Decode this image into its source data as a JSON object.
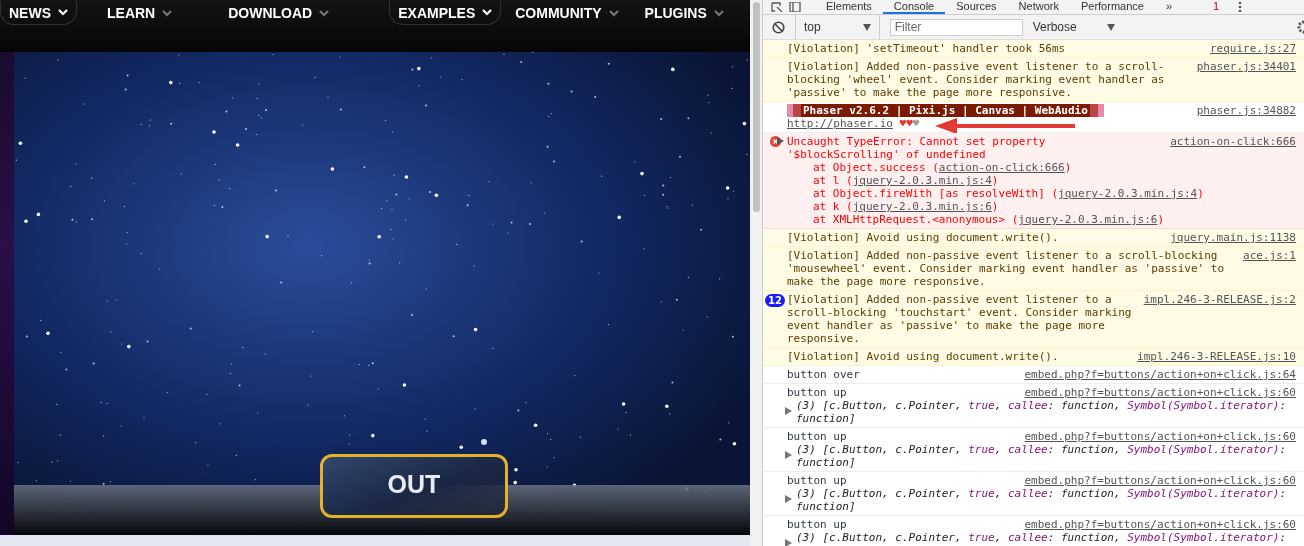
{
  "site_nav": {
    "items": [
      {
        "label": "NEWS",
        "outlined": true
      },
      {
        "label": "LEARN",
        "outlined": false
      },
      {
        "label": "DOWNLOAD",
        "outlined": false
      },
      {
        "label": "EXAMPLES",
        "outlined": true
      },
      {
        "label": "COMMUNITY",
        "outlined": false
      },
      {
        "label": "PLUGINS",
        "outlined": false
      }
    ]
  },
  "game": {
    "button_label": "OUT"
  },
  "devtools": {
    "tabs": [
      {
        "label": "Elements",
        "selected": false
      },
      {
        "label": "Console",
        "selected": true
      },
      {
        "label": "Sources",
        "selected": false
      },
      {
        "label": "Network",
        "selected": false
      },
      {
        "label": "Performance",
        "selected": false
      }
    ],
    "overflow": "»",
    "error_count": "1",
    "context": "top",
    "filter": {
      "placeholder": "Filter"
    },
    "level": "Verbose",
    "messages": [
      {
        "kind": "violation",
        "text": "[Violation] 'setTimeout' handler took 56ms",
        "source": "require.js:27"
      },
      {
        "kind": "violation",
        "text": "[Violation] Added non-passive event listener to a scroll-blocking 'wheel' event. Consider marking event handler as 'passive' to make the page more responsive.",
        "source": "phaser.js:34401"
      },
      {
        "kind": "banner",
        "banner": "Phaser v2.6.2 | Pixi.js | Canvas | WebAudio",
        "link": "http://phaser.io",
        "hearts": [
          {
            "char": "♥",
            "color": "#e53935"
          },
          {
            "char": "♥",
            "color": "#e53935"
          },
          {
            "char": "♥",
            "color": "#9e9e9e"
          }
        ],
        "source": "phaser.js:34882"
      },
      {
        "kind": "error",
        "text": "Uncaught TypeError: Cannot set property '$blockScrolling' of undefined",
        "source": "action-on-click:666",
        "stack": [
          {
            "text": "at Object.success (",
            "link": "action-on-click:666",
            "end": ")"
          },
          {
            "text": "at l (",
            "link": "jquery-2.0.3.min.js:4",
            "end": ")"
          },
          {
            "text": "at Object.fireWith [as resolveWith] (",
            "link": "jquery-2.0.3.min.js:4",
            "end": ")"
          },
          {
            "text": "at k (",
            "link": "jquery-2.0.3.min.js:6",
            "end": ")"
          },
          {
            "text": "at XMLHttpRequest.<anonymous> (",
            "link": "jquery-2.0.3.min.js:6",
            "end": ")"
          }
        ]
      },
      {
        "kind": "violation",
        "text": "[Violation] Avoid using document.write().",
        "source": "jquery.main.js:1138"
      },
      {
        "kind": "violation",
        "text": "[Violation] Added non-passive event listener to a scroll-blocking 'mousewheel' event. Consider marking event handler as 'passive' to make the page more responsive.",
        "source": "ace.js:1"
      },
      {
        "kind": "violation",
        "count": "12",
        "text": "[Violation] Added non-passive event listener to a scroll-blocking 'touchstart' event. Consider marking event handler as 'passive' to make the page more responsive.",
        "source": "impl.246-3-RELEASE.js:2"
      },
      {
        "kind": "violation",
        "text": "[Violation] Avoid using document.write().",
        "source": "impl.246-3-RELEASE.js:10"
      },
      {
        "kind": "log",
        "text": "button over",
        "source": "embed.php?f=buttons/action+on+click.js:64"
      },
      {
        "kind": "log",
        "text": "button up",
        "source": "embed.php?f=buttons/action+on+click.js:60",
        "object": [
          {
            "text": "(3) [c.Button, c.Pointer, ",
            "kind": "plain"
          },
          {
            "text": "true",
            "kind": "keyword"
          },
          {
            "text": ", ",
            "kind": "plain"
          },
          {
            "text": "callee",
            "kind": "key"
          },
          {
            "text": ": function, ",
            "kind": "plain"
          },
          {
            "text": "Symbol(Symbol.iterator)",
            "kind": "key"
          },
          {
            "text": ": function]",
            "kind": "plain"
          }
        ]
      },
      {
        "kind": "log",
        "text": "button up",
        "source": "embed.php?f=buttons/action+on+click.js:60",
        "object": [
          {
            "text": "(3) [c.Button, c.Pointer, ",
            "kind": "plain"
          },
          {
            "text": "true",
            "kind": "keyword"
          },
          {
            "text": ", ",
            "kind": "plain"
          },
          {
            "text": "callee",
            "kind": "key"
          },
          {
            "text": ": function, ",
            "kind": "plain"
          },
          {
            "text": "Symbol(Symbol.iterator)",
            "kind": "key"
          },
          {
            "text": ": function]",
            "kind": "plain"
          }
        ]
      },
      {
        "kind": "log",
        "text": "button up",
        "source": "embed.php?f=buttons/action+on+click.js:60",
        "object": [
          {
            "text": "(3) [c.Button, c.Pointer, ",
            "kind": "plain"
          },
          {
            "text": "true",
            "kind": "keyword"
          },
          {
            "text": ", ",
            "kind": "plain"
          },
          {
            "text": "callee",
            "kind": "key"
          },
          {
            "text": ": function, ",
            "kind": "plain"
          },
          {
            "text": "Symbol(Symbol.iterator)",
            "kind": "key"
          },
          {
            "text": ": function]",
            "kind": "plain"
          }
        ]
      },
      {
        "kind": "log",
        "text": "button up",
        "source": "embed.php?f=buttons/action+on+click.js:60",
        "object": [
          {
            "text": "(3) [c.Button, c.Pointer, ",
            "kind": "plain"
          },
          {
            "text": "true",
            "kind": "keyword"
          },
          {
            "text": ", ",
            "kind": "plain"
          },
          {
            "text": "callee",
            "kind": "key"
          },
          {
            "text": ": function, ",
            "kind": "plain"
          },
          {
            "text": "Symbol(Symbol.iterator)",
            "kind": "key"
          },
          {
            "text": ":",
            "kind": "plain"
          }
        ]
      }
    ]
  }
}
